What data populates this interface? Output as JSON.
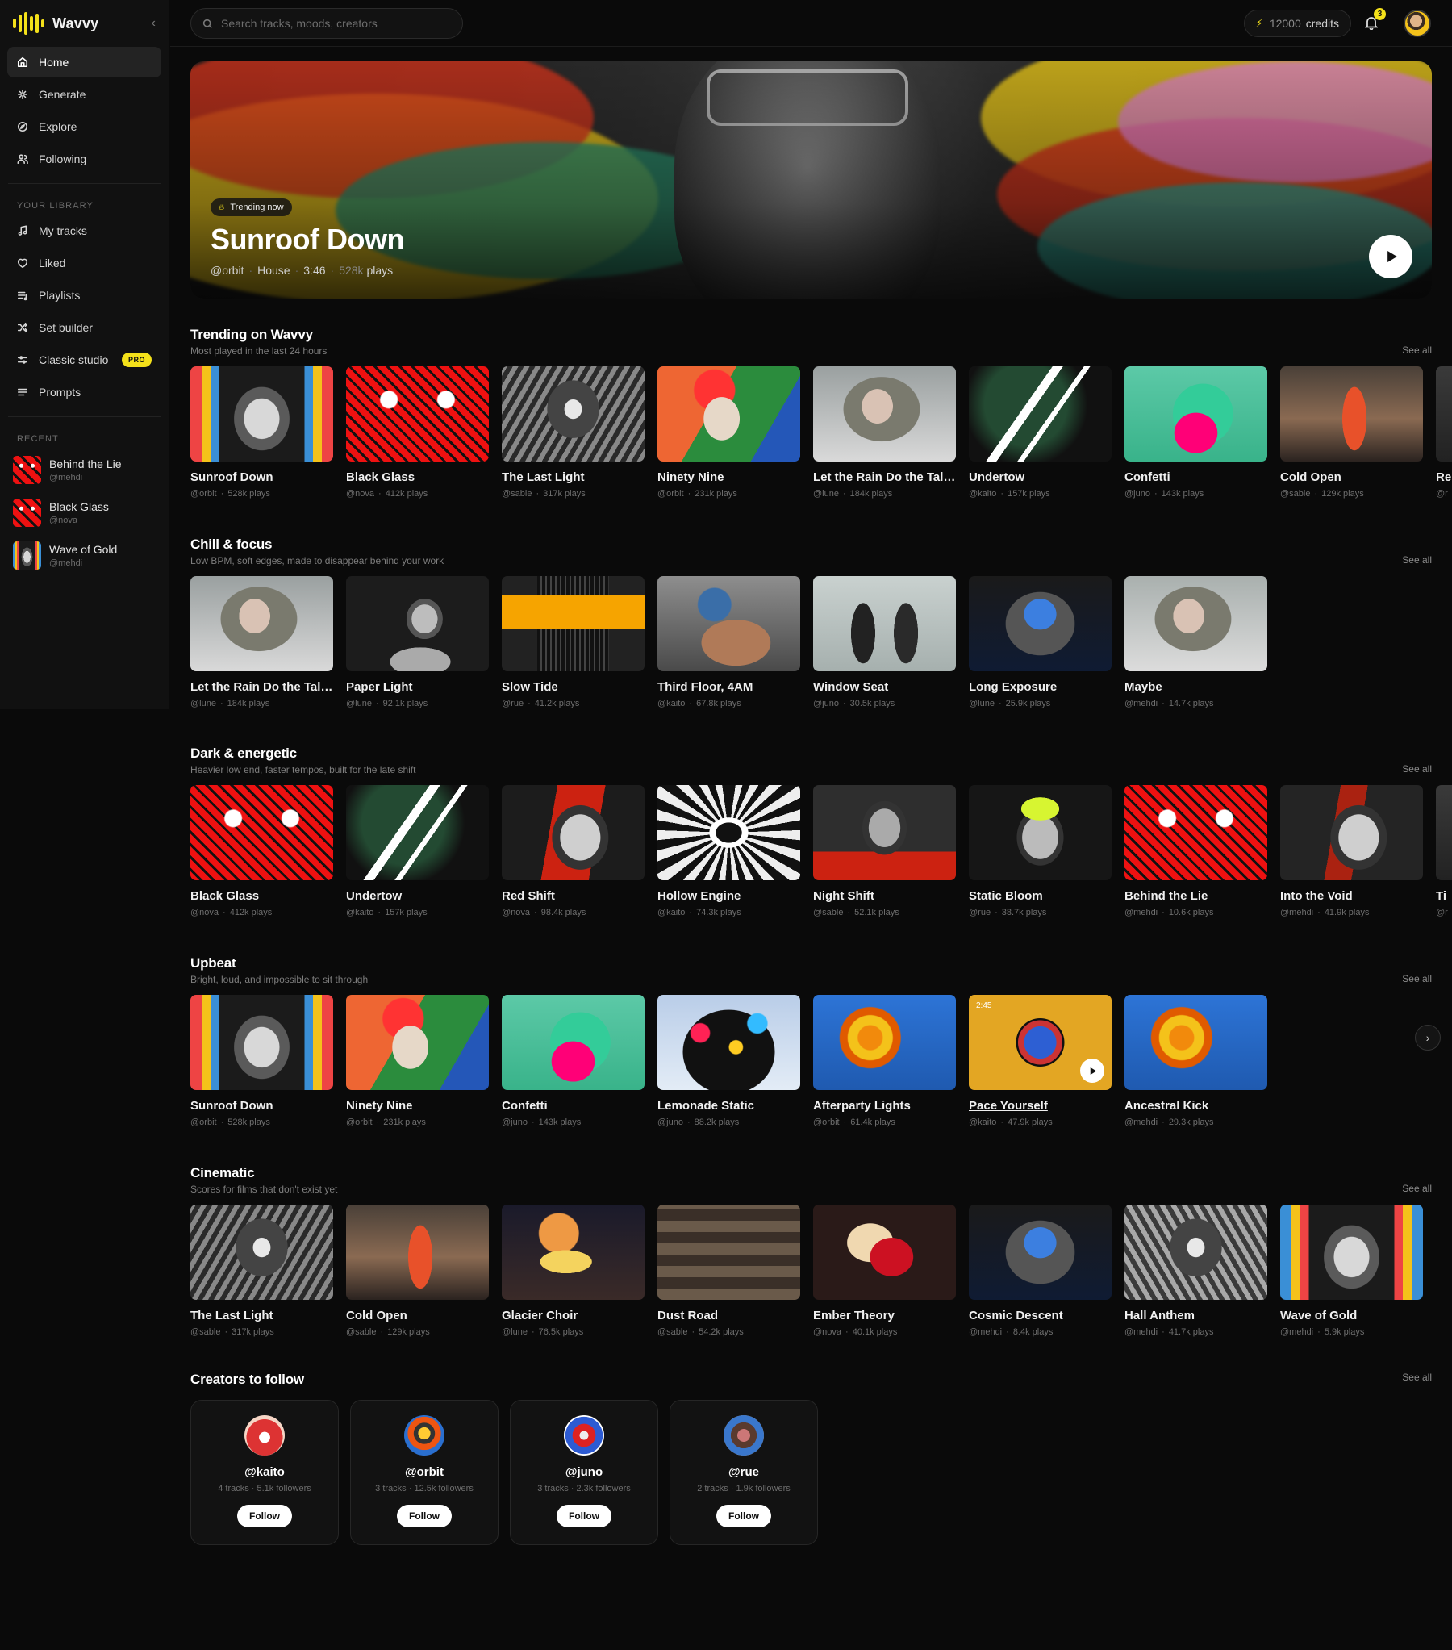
{
  "app": {
    "name": "Wavvy",
    "accent": "#f4e11a"
  },
  "nav": [
    {
      "label": "Home",
      "icon": "home-icon",
      "active": true
    },
    {
      "label": "Generate",
      "icon": "sparkle-icon"
    },
    {
      "label": "Explore",
      "icon": "compass-icon"
    },
    {
      "label": "Following",
      "icon": "users-icon"
    }
  ],
  "library": {
    "label": "YOUR LIBRARY",
    "items": [
      {
        "label": "My tracks",
        "icon": "music-note-icon"
      },
      {
        "label": "Liked",
        "icon": "heart-icon"
      },
      {
        "label": "Playlists",
        "icon": "playlist-icon"
      },
      {
        "label": "Set builder",
        "icon": "shuffle-icon"
      },
      {
        "label": "Classic studio",
        "icon": "sliders-icon",
        "badge": "PRO"
      },
      {
        "label": "Prompts",
        "icon": "lines-icon"
      }
    ]
  },
  "recent": {
    "label": "RECENT",
    "items": [
      {
        "title": "Behind the Lie",
        "creator": "@mehdi",
        "art": "a-black"
      },
      {
        "title": "Black Glass",
        "creator": "@nova",
        "art": "a-black"
      },
      {
        "title": "Wave of Gold",
        "creator": "@mehdi",
        "art": "a-wave"
      }
    ]
  },
  "topbar": {
    "search_placeholder": "Search tracks, moods, creators",
    "credits_value": "12000",
    "credits_label": "credits",
    "notifications": "3"
  },
  "hero": {
    "badge": "Trending now",
    "title": "Sunroof Down",
    "creator": "@orbit",
    "genre": "House",
    "duration": "3:46",
    "plays_value": "528k",
    "plays_label": "plays"
  },
  "see_all": "See all",
  "sections": [
    {
      "title": "Trending on Wavvy",
      "subtitle": "Most played in the last 24 hours",
      "cards": [
        {
          "title": "Sunroof Down",
          "creator": "@orbit",
          "plays": "528k plays",
          "art": "a-sunroof"
        },
        {
          "title": "Black Glass",
          "creator": "@nova",
          "plays": "412k plays",
          "art": "a-black"
        },
        {
          "title": "The Last Light",
          "creator": "@sable",
          "plays": "317k plays",
          "art": "a-lastlight"
        },
        {
          "title": "Ninety Nine",
          "creator": "@orbit",
          "plays": "231k plays",
          "art": "a-ninety"
        },
        {
          "title": "Let the Rain Do the Talki...",
          "creator": "@lune",
          "plays": "184k plays",
          "art": "a-rain"
        },
        {
          "title": "Undertow",
          "creator": "@kaito",
          "plays": "157k plays",
          "art": "a-undertow"
        },
        {
          "title": "Confetti",
          "creator": "@juno",
          "plays": "143k plays",
          "art": "a-confetti"
        },
        {
          "title": "Cold Open",
          "creator": "@sable",
          "plays": "129k plays",
          "art": "a-coldopen"
        },
        {
          "title": "Re",
          "creator": "@r",
          "plays": "",
          "art": "a-partial"
        }
      ]
    },
    {
      "title": "Chill & focus",
      "subtitle": "Low BPM, soft edges, made to disappear behind your work",
      "cards": [
        {
          "title": "Let the Rain Do the Talki...",
          "creator": "@lune",
          "plays": "184k plays",
          "art": "a-rain"
        },
        {
          "title": "Paper Light",
          "creator": "@lune",
          "plays": "92.1k plays",
          "art": "a-paper"
        },
        {
          "title": "Slow Tide",
          "creator": "@rue",
          "plays": "41.2k plays",
          "art": "a-slowtide"
        },
        {
          "title": "Third Floor, 4AM",
          "creator": "@kaito",
          "plays": "67.8k plays",
          "art": "a-third"
        },
        {
          "title": "Window Seat",
          "creator": "@juno",
          "plays": "30.5k plays",
          "art": "a-window"
        },
        {
          "title": "Long Exposure",
          "creator": "@lune",
          "plays": "25.9k plays",
          "art": "a-long"
        },
        {
          "title": "Maybe",
          "creator": "@mehdi",
          "plays": "14.7k plays",
          "art": "a-maybe"
        }
      ]
    },
    {
      "title": "Dark & energetic",
      "subtitle": "Heavier low end, faster tempos, built for the late shift",
      "cards": [
        {
          "title": "Black Glass",
          "creator": "@nova",
          "plays": "412k plays",
          "art": "a-black"
        },
        {
          "title": "Undertow",
          "creator": "@kaito",
          "plays": "157k plays",
          "art": "a-undertow"
        },
        {
          "title": "Red Shift",
          "creator": "@nova",
          "plays": "98.4k plays",
          "art": "a-redshift"
        },
        {
          "title": "Hollow Engine",
          "creator": "@kaito",
          "plays": "74.3k plays",
          "art": "a-hollow"
        },
        {
          "title": "Night Shift",
          "creator": "@sable",
          "plays": "52.1k plays",
          "art": "a-night"
        },
        {
          "title": "Static Bloom",
          "creator": "@rue",
          "plays": "38.7k plays",
          "art": "a-static"
        },
        {
          "title": "Behind the Lie",
          "creator": "@mehdi",
          "plays": "10.6k plays",
          "art": "a-black"
        },
        {
          "title": "Into the Void",
          "creator": "@mehdi",
          "plays": "41.9k plays",
          "art": "a-void"
        },
        {
          "title": "Ti",
          "creator": "@r",
          "plays": "",
          "art": "a-partial"
        }
      ]
    },
    {
      "title": "Upbeat",
      "subtitle": "Bright, loud, and impossible to sit through",
      "cards": [
        {
          "title": "Sunroof Down",
          "creator": "@orbit",
          "plays": "528k plays",
          "art": "a-sunroof"
        },
        {
          "title": "Ninety Nine",
          "creator": "@orbit",
          "plays": "231k plays",
          "art": "a-ninety"
        },
        {
          "title": "Confetti",
          "creator": "@juno",
          "plays": "143k plays",
          "art": "a-confetti"
        },
        {
          "title": "Lemonade Static",
          "creator": "@juno",
          "plays": "88.2k plays",
          "art": "a-lemonade"
        },
        {
          "title": "Afterparty Lights",
          "creator": "@orbit",
          "plays": "61.4k plays",
          "art": "a-after"
        },
        {
          "title": "Pace Yourself",
          "creator": "@kaito",
          "plays": "47.9k plays",
          "art": "a-pace",
          "hover": true,
          "duration": "2:45"
        },
        {
          "title": "Ancestral Kick",
          "creator": "@mehdi",
          "plays": "29.3k plays",
          "art": "a-after"
        }
      ]
    },
    {
      "title": "Cinematic",
      "subtitle": "Scores for films that don't exist yet",
      "cards": [
        {
          "title": "The Last Light",
          "creator": "@sable",
          "plays": "317k plays",
          "art": "a-lastlight"
        },
        {
          "title": "Cold Open",
          "creator": "@sable",
          "plays": "129k plays",
          "art": "a-coldopen"
        },
        {
          "title": "Glacier Choir",
          "creator": "@lune",
          "plays": "76.5k plays",
          "art": "a-glacier"
        },
        {
          "title": "Dust Road",
          "creator": "@sable",
          "plays": "54.2k plays",
          "art": "a-dust"
        },
        {
          "title": "Ember Theory",
          "creator": "@nova",
          "plays": "40.1k plays",
          "art": "a-ember"
        },
        {
          "title": "Cosmic Descent",
          "creator": "@mehdi",
          "plays": "8.4k plays",
          "art": "a-long"
        },
        {
          "title": "Hall Anthem",
          "creator": "@mehdi",
          "plays": "41.7k plays",
          "art": "a-hall"
        },
        {
          "title": "Wave of Gold",
          "creator": "@mehdi",
          "plays": "5.9k plays",
          "art": "a-wave"
        }
      ]
    }
  ],
  "creators": {
    "title": "Creators to follow",
    "follow_label": "Follow",
    "items": [
      {
        "handle": "@kaito",
        "stats": "4 tracks · 5.1k followers",
        "avatar": "av-kaito"
      },
      {
        "handle": "@orbit",
        "stats": "3 tracks · 12.5k followers",
        "avatar": "av-orbit"
      },
      {
        "handle": "@juno",
        "stats": "3 tracks · 2.3k followers",
        "avatar": "av-juno"
      },
      {
        "handle": "@rue",
        "stats": "2 tracks · 1.9k followers",
        "avatar": "av-rue"
      }
    ]
  }
}
